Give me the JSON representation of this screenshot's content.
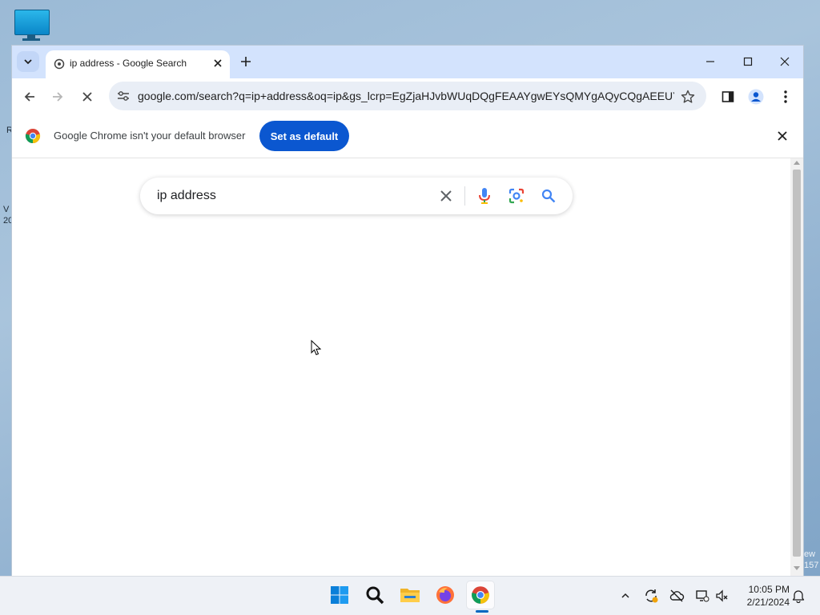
{
  "desktop": {
    "edge_texts": [
      "R",
      "V",
      "20",
      "ew",
      "157"
    ]
  },
  "browser": {
    "tab": {
      "title": "ip address - Google Search"
    },
    "toolbar": {
      "url": "google.com/search?q=ip+address&oq=ip&gs_lcrp=EgZjaHJvbWUqDQgFEAAYgwEYsQMYgAQyCQgAEEUY..."
    },
    "infobar": {
      "message": "Google Chrome isn't your default browser",
      "button_label": "Set as default"
    },
    "page": {
      "search_query": "ip address"
    }
  },
  "taskbar": {
    "apps": [
      "start-menu",
      "search",
      "file-explorer",
      "firefox",
      "chrome"
    ],
    "active_app": "chrome",
    "clock": {
      "time": "10:05 PM",
      "date": "2/21/2024"
    }
  },
  "colors": {
    "tabbar": "#d3e3fd",
    "accent_button": "#0b57d0",
    "omnibox": "#e9eef6"
  }
}
